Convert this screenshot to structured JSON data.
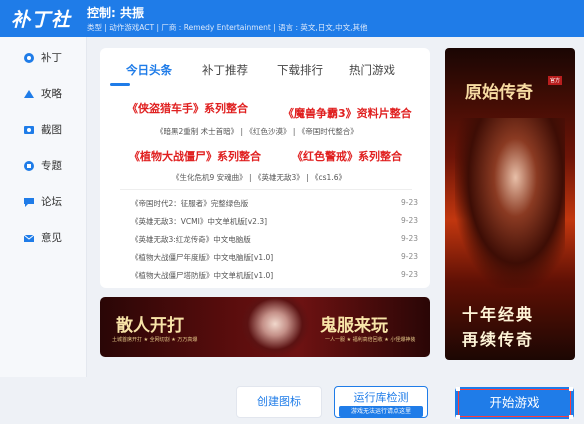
{
  "app": {
    "logo_text": "补丁社",
    "title": "控制: 共振",
    "meta": "类型 | 动作游戏ACT | 厂商 : Remedy Entertainment | 语言 : 英文,日文,中文,其他"
  },
  "sidebar": {
    "items": [
      {
        "label": "补丁",
        "icon": "patch-icon"
      },
      {
        "label": "攻略",
        "icon": "guide-icon"
      },
      {
        "label": "截图",
        "icon": "screenshot-icon"
      },
      {
        "label": "专题",
        "icon": "topic-icon"
      },
      {
        "label": "论坛",
        "icon": "forum-icon"
      },
      {
        "label": "意见",
        "icon": "feedback-icon"
      }
    ]
  },
  "tabs": [
    {
      "label": "今日头条",
      "active": true
    },
    {
      "label": "补丁推荐",
      "active": false
    },
    {
      "label": "下载排行",
      "active": false
    },
    {
      "label": "热门游戏",
      "active": false
    }
  ],
  "headlines": {
    "row1_left": "《侠盗猎车手》系列整合",
    "row1_right": "《魔兽争霸3》资料片整合",
    "sub1": "《暗黑2重制 术士首暗》 | 《红色沙漠》 | 《帝国时代整合》",
    "row2_left": "《植物大战僵尸》系列整合",
    "row2_right": "《红色警戒》系列整合",
    "sub2": "《生化危机9 安魂曲》 | 《英雄无敌3》 | 《cs1.6》"
  },
  "news": [
    {
      "title": "《帝国时代2：征服者》完整绿色版",
      "date": "9-23"
    },
    {
      "title": "《英雄无敌3：VCMI》中文单机版[v2.3]",
      "date": "9-23"
    },
    {
      "title": "《英雄无敌3:红龙传奇》中文电脑版",
      "date": "9-23"
    },
    {
      "title": "《植物大战僵尸年度版》中文电脑版[v1.0]",
      "date": "9-23"
    },
    {
      "title": "《植物大战僵尸塔防版》中文单机版[v1.0]",
      "date": "9-23"
    }
  ],
  "banner": {
    "left_title": "散人开打",
    "left_sub": "土城首席开打 ★ 全网切割 ★ 万万高爆",
    "right_title": "鬼服来玩",
    "right_sub": "一人一服 ★ 福利高倍回收 ★ 小怪爆神装"
  },
  "ad": {
    "title": "原始传奇",
    "badge": "官方",
    "line1": "十年经典",
    "line2": "再续传奇"
  },
  "footer": {
    "create_icon_label": "创建图标",
    "runtime_check_label": "运行库检测",
    "runtime_check_sub": "游戏无法运行请点这里",
    "start_label": "开始游戏"
  },
  "colors": {
    "accent": "#1f7ce8",
    "headline": "#e02020"
  }
}
